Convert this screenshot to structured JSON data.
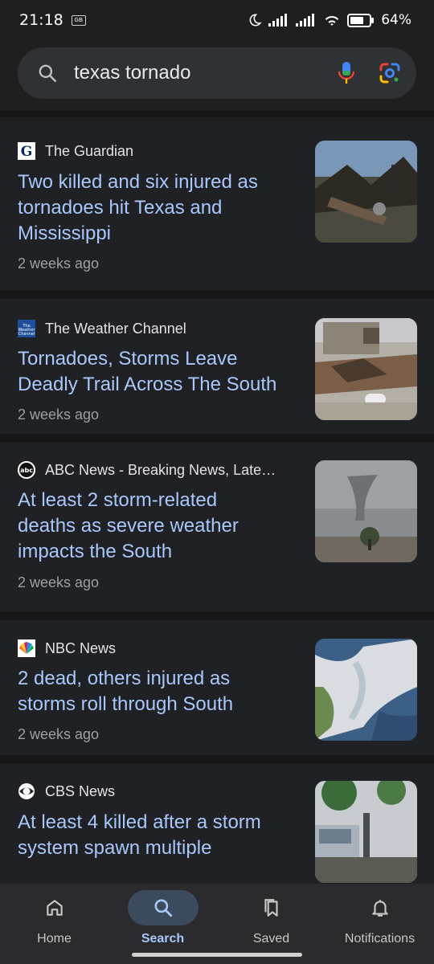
{
  "status_bar": {
    "time": "21:18",
    "badge": "GB",
    "battery": "64%"
  },
  "search": {
    "query": "texas tornado"
  },
  "results": [
    {
      "source": "The Guardian",
      "favicon_text": "G",
      "favicon_color": "#ffffff",
      "headline_lines": [
        "Two killed and six injured as",
        "tornadoes hit Texas and",
        "Mississippi"
      ],
      "age": "2 weeks ago",
      "thumb_icon": "tornado-damage-photo"
    },
    {
      "source": "The Weather Channel",
      "favicon_text": "The Weather Channel",
      "favicon_color": "#1f4e9c",
      "headline_lines": [
        "Tornadoes, Storms Leave",
        "Deadly Trail Across The South"
      ],
      "age": "2 weeks ago",
      "thumb_icon": "storm-debris-photo"
    },
    {
      "source": "ABC News - Breaking News, Late…",
      "favicon_text": "abc",
      "favicon_color": "#ffffff",
      "headline_lines": [
        "At least 2 storm-related",
        "deaths as severe weather",
        "impacts the South"
      ],
      "age": "2 weeks ago",
      "thumb_icon": "funnel-cloud-photo"
    },
    {
      "source": "NBC News",
      "favicon_text": "",
      "favicon_color": "#ffffff",
      "headline_lines": [
        "2 dead, others injured as",
        "storms roll through South"
      ],
      "age": "2 weeks ago",
      "thumb_icon": "satellite-storm-photo"
    },
    {
      "source": "CBS News",
      "favicon_text": "",
      "favicon_color": "#ffffff",
      "headline_lines": [
        "At least 4 killed after a storm",
        "system spawn multiple"
      ],
      "age": "",
      "thumb_icon": "storm-street-photo"
    }
  ],
  "nav": [
    {
      "label": "Home",
      "icon": "home-icon",
      "active": false
    },
    {
      "label": "Search",
      "icon": "search-icon",
      "active": true
    },
    {
      "label": "Saved",
      "icon": "bookmarks-icon",
      "active": false
    },
    {
      "label": "Notifications",
      "icon": "bell-icon",
      "active": false
    }
  ]
}
